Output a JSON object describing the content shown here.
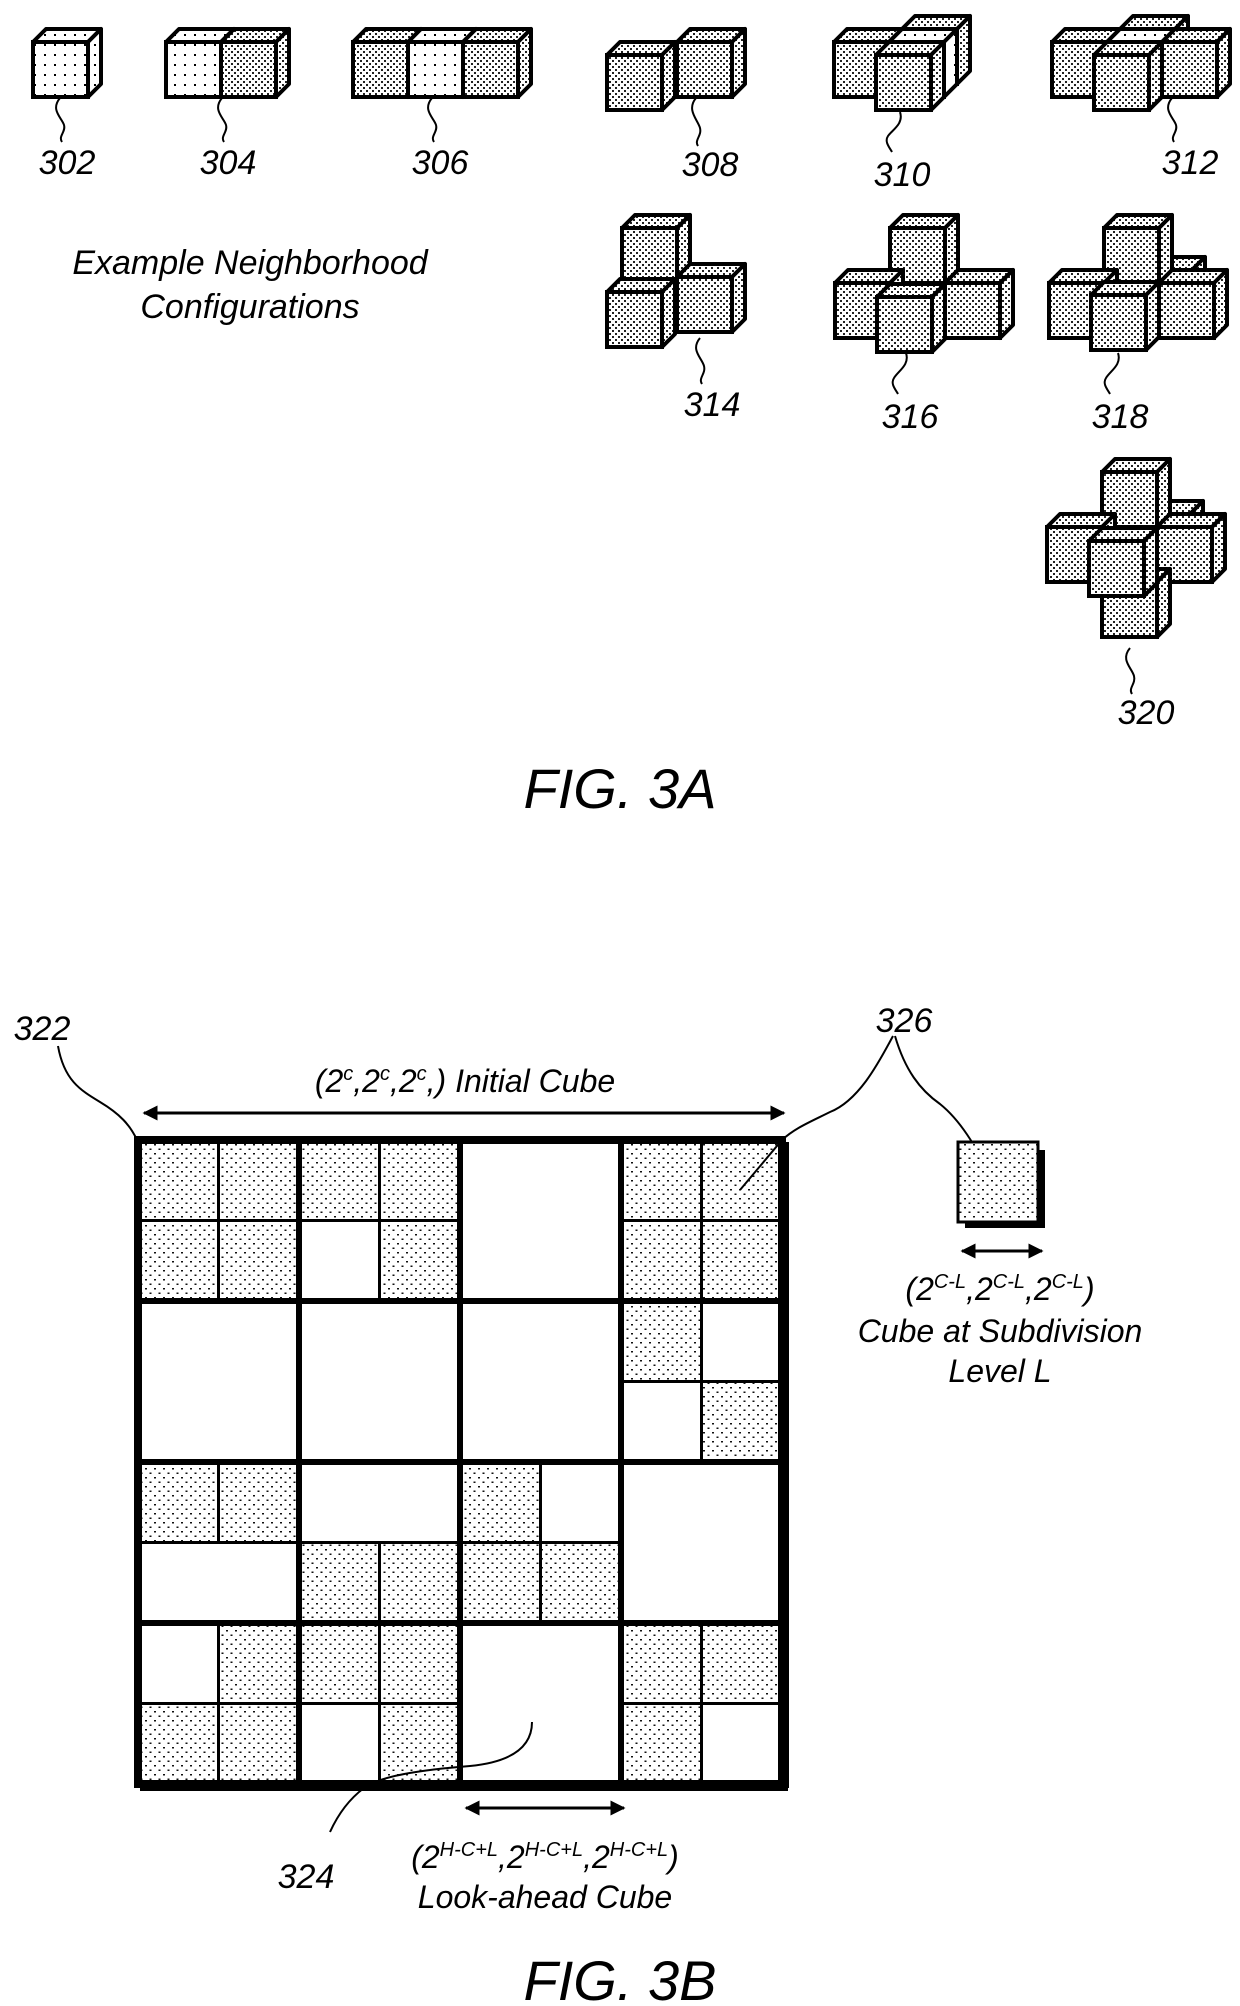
{
  "fig3a": {
    "caption": "FIG. 3A",
    "title_line1": "Example Neighborhood",
    "title_line2": "Configurations",
    "configurations": [
      {
        "ref": "302",
        "cubes": [
          "center"
        ],
        "center_fill": "sparse"
      },
      {
        "ref": "304",
        "cubes": [
          "center",
          "right"
        ],
        "center_fill": "sparse"
      },
      {
        "ref": "306",
        "cubes": [
          "left",
          "center",
          "right"
        ],
        "center_fill": "sparse"
      },
      {
        "ref": "308",
        "cubes": [
          "center",
          "front-left"
        ],
        "center_fill": "dense"
      },
      {
        "ref": "310",
        "cubes": [
          "back",
          "center",
          "left",
          "front"
        ],
        "center_fill": "sparse"
      },
      {
        "ref": "312",
        "cubes": [
          "back",
          "left",
          "center",
          "right",
          "front"
        ],
        "center_fill": "sparse"
      },
      {
        "ref": "314",
        "cubes": [
          "top",
          "right",
          "front-left"
        ],
        "center_fill": "dense"
      },
      {
        "ref": "316",
        "cubes": [
          "top",
          "right",
          "left",
          "front"
        ],
        "center_fill": "dense"
      },
      {
        "ref": "318",
        "cubes": [
          "top",
          "back",
          "left",
          "right",
          "front"
        ],
        "center_fill": "dense"
      },
      {
        "ref": "320",
        "cubes": [
          "top",
          "back",
          "left",
          "right",
          "bottom",
          "front"
        ],
        "center_fill": "dense"
      }
    ]
  },
  "fig3b": {
    "caption": "FIG. 3B",
    "ref_grid": "322",
    "ref_lookahead": "324",
    "ref_cube": "326",
    "initial_cube": {
      "open": "(2",
      "sup": "c",
      "sep": ",",
      "close": ",) Initial Cube"
    },
    "level_cube": {
      "base": "2",
      "sup": "C-L",
      "line2": "Cube at Subdivision",
      "line3": "Level L"
    },
    "lookahead_cube": {
      "base": "2",
      "sup": "H-C+L",
      "line2": "Look-ahead Cube"
    },
    "grid_blocks": [
      [
        {
          "split": "quad",
          "fill": [
            1,
            1,
            1,
            1
          ]
        },
        {
          "split": "quad",
          "fill": [
            1,
            1,
            0,
            1
          ]
        },
        {
          "split": "none",
          "fill": [
            0
          ]
        },
        {
          "split": "quad",
          "fill": [
            1,
            1,
            1,
            1
          ]
        }
      ],
      [
        {
          "split": "none",
          "fill": [
            0
          ]
        },
        {
          "split": "none",
          "fill": [
            0
          ]
        },
        {
          "split": "none",
          "fill": [
            0
          ]
        },
        {
          "split": "quad",
          "fill": [
            1,
            0,
            0,
            1
          ]
        }
      ],
      [
        {
          "split": "top-pair",
          "fill": [
            1,
            1,
            0
          ]
        },
        {
          "split": "bottom-pair",
          "fill": [
            0,
            1,
            1
          ]
        },
        {
          "split": "quad",
          "fill": [
            1,
            0,
            1,
            1
          ]
        },
        {
          "split": "none",
          "fill": [
            0
          ]
        }
      ],
      [
        {
          "split": "quad",
          "fill": [
            0,
            1,
            1,
            1
          ]
        },
        {
          "split": "quad",
          "fill": [
            1,
            1,
            0,
            1
          ]
        },
        {
          "split": "none",
          "fill": [
            0
          ]
        },
        {
          "split": "quad",
          "fill": [
            1,
            1,
            1,
            0
          ]
        }
      ]
    ]
  }
}
